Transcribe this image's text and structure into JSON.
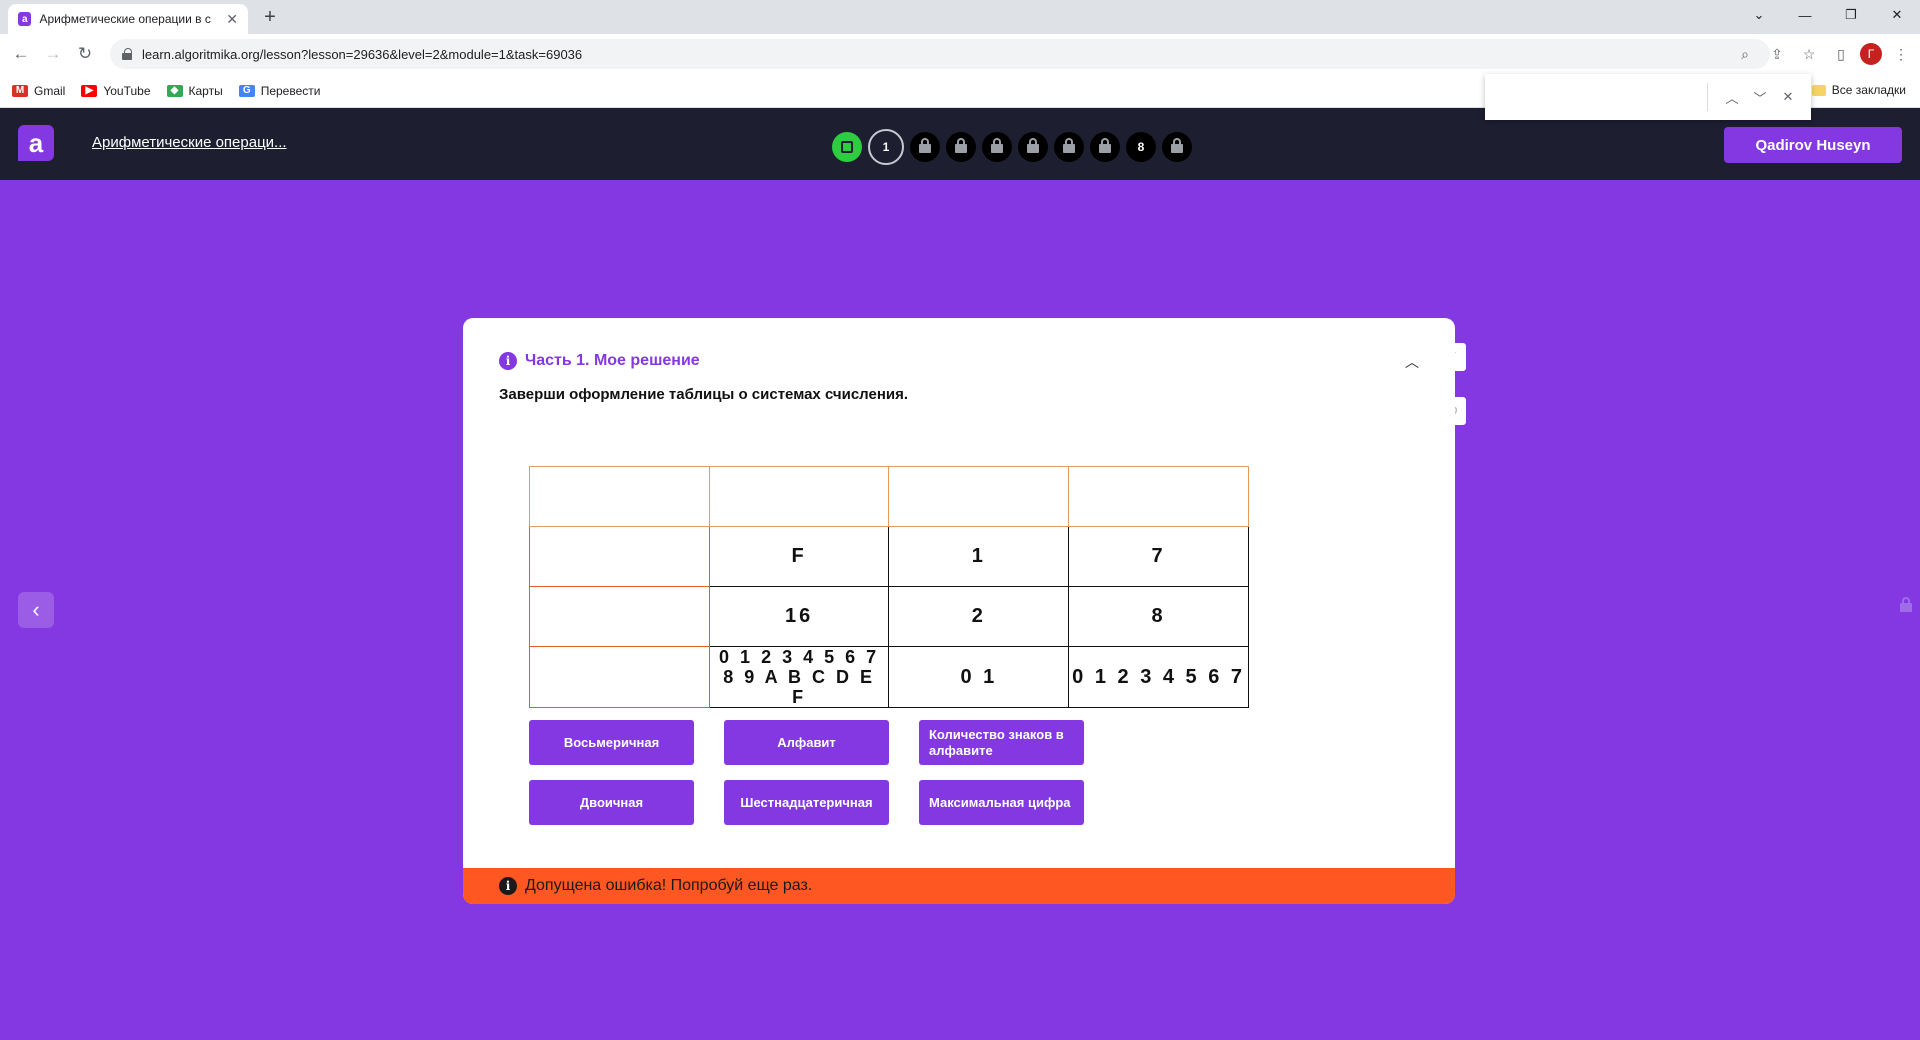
{
  "browser": {
    "tab_title": "Арифметические операции в с",
    "tab_close": "✕",
    "new_tab": "+",
    "url": "learn.algoritmika.org/lesson?lesson=29636&level=2&module=1&task=69036",
    "profile_letter": "Г",
    "bookmarks": [
      {
        "label": "Gmail",
        "icon": "gmail-icon",
        "color": "#d93025"
      },
      {
        "label": "YouTube",
        "icon": "youtube-icon",
        "color": "#ff0000"
      },
      {
        "label": "Карты",
        "icon": "maps-icon",
        "color": "#34a853"
      },
      {
        "label": "Перевести",
        "icon": "translate-icon",
        "color": "#4285f4"
      }
    ],
    "all_bookmarks": "Все закладки",
    "find_value": ""
  },
  "header": {
    "logo": "a",
    "lesson_title": "Арифметические операци...",
    "steps": [
      {
        "type": "done",
        "label": ""
      },
      {
        "type": "current",
        "label": "1"
      },
      {
        "type": "locked",
        "label": ""
      },
      {
        "type": "locked",
        "label": ""
      },
      {
        "type": "locked",
        "label": ""
      },
      {
        "type": "locked",
        "label": ""
      },
      {
        "type": "locked",
        "label": ""
      },
      {
        "type": "locked",
        "label": ""
      },
      {
        "type": "num",
        "label": "8"
      },
      {
        "type": "locked",
        "label": ""
      }
    ],
    "user_name": "Qadirov Huseyn"
  },
  "task": {
    "part_title": "Часть 1. Мое решение",
    "instruction": "Заверши оформление таблицы о системах счисления.",
    "table": [
      [
        "",
        "",
        "",
        ""
      ],
      [
        "",
        "F",
        "1",
        "7"
      ],
      [
        "",
        "16",
        "2",
        "8"
      ],
      [
        "",
        "0 1 2 3 4 5 6 7 8 9 A B C D E F",
        "0 1",
        "0 1 2 3 4 5 6 7"
      ]
    ],
    "chips": [
      {
        "label": "Восьмеричная"
      },
      {
        "label": "Алфавит"
      },
      {
        "label": "Количество знаков в алфавите"
      },
      {
        "label": "Двоичная"
      },
      {
        "label": "Шестнадцатеричная"
      },
      {
        "label": "Максимальная цифра"
      }
    ],
    "error": "Допущена ошибка! Попробуй еще раз."
  },
  "colors": {
    "accent": "#8338e1",
    "header_bg": "#1d1f31",
    "error": "#ff5722",
    "done_step": "#2ecc40"
  }
}
